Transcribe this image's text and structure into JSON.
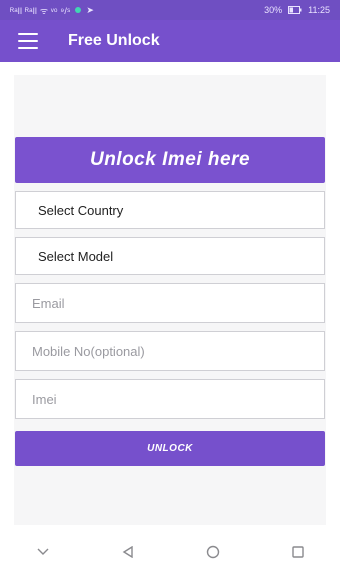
{
  "status_bar": {
    "left": "ᴿᵃll ᴿᵃll ᯤ ᵛᵒ ⁹/ˢ",
    "battery": "30%",
    "time": "11:25"
  },
  "app_bar": {
    "menu_icon": "menu-icon",
    "title": "Free Unlock"
  },
  "form": {
    "banner": "Unlock Imei here",
    "country_select": "Select Country",
    "model_select": "Select Model",
    "email_placeholder": "Email",
    "mobile_placeholder": "Mobile No(optional)",
    "imei_placeholder": "Imei",
    "unlock_button": "UNLOCK"
  },
  "nav_bar": {
    "icons": [
      "chevron-down-icon",
      "back-icon",
      "home-icon",
      "recents-icon"
    ]
  },
  "colors": {
    "primary": "#7650cc",
    "status_bar": "#6f4fc2"
  }
}
